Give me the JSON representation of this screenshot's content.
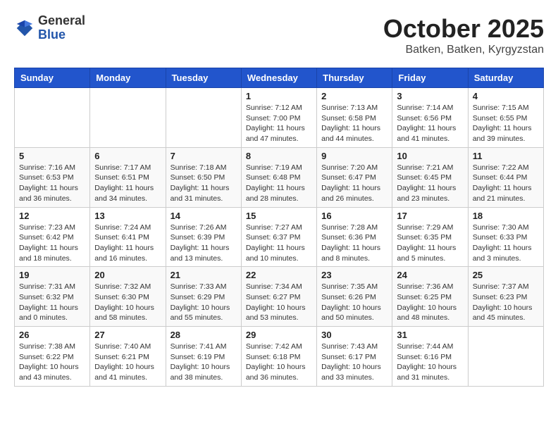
{
  "header": {
    "logo_general": "General",
    "logo_blue": "Blue",
    "month": "October 2025",
    "location": "Batken, Batken, Kyrgyzstan"
  },
  "weekdays": [
    "Sunday",
    "Monday",
    "Tuesday",
    "Wednesday",
    "Thursday",
    "Friday",
    "Saturday"
  ],
  "weeks": [
    [
      {
        "day": "",
        "info": ""
      },
      {
        "day": "",
        "info": ""
      },
      {
        "day": "",
        "info": ""
      },
      {
        "day": "1",
        "info": "Sunrise: 7:12 AM\nSunset: 7:00 PM\nDaylight: 11 hours\nand 47 minutes."
      },
      {
        "day": "2",
        "info": "Sunrise: 7:13 AM\nSunset: 6:58 PM\nDaylight: 11 hours\nand 44 minutes."
      },
      {
        "day": "3",
        "info": "Sunrise: 7:14 AM\nSunset: 6:56 PM\nDaylight: 11 hours\nand 41 minutes."
      },
      {
        "day": "4",
        "info": "Sunrise: 7:15 AM\nSunset: 6:55 PM\nDaylight: 11 hours\nand 39 minutes."
      }
    ],
    [
      {
        "day": "5",
        "info": "Sunrise: 7:16 AM\nSunset: 6:53 PM\nDaylight: 11 hours\nand 36 minutes."
      },
      {
        "day": "6",
        "info": "Sunrise: 7:17 AM\nSunset: 6:51 PM\nDaylight: 11 hours\nand 34 minutes."
      },
      {
        "day": "7",
        "info": "Sunrise: 7:18 AM\nSunset: 6:50 PM\nDaylight: 11 hours\nand 31 minutes."
      },
      {
        "day": "8",
        "info": "Sunrise: 7:19 AM\nSunset: 6:48 PM\nDaylight: 11 hours\nand 28 minutes."
      },
      {
        "day": "9",
        "info": "Sunrise: 7:20 AM\nSunset: 6:47 PM\nDaylight: 11 hours\nand 26 minutes."
      },
      {
        "day": "10",
        "info": "Sunrise: 7:21 AM\nSunset: 6:45 PM\nDaylight: 11 hours\nand 23 minutes."
      },
      {
        "day": "11",
        "info": "Sunrise: 7:22 AM\nSunset: 6:44 PM\nDaylight: 11 hours\nand 21 minutes."
      }
    ],
    [
      {
        "day": "12",
        "info": "Sunrise: 7:23 AM\nSunset: 6:42 PM\nDaylight: 11 hours\nand 18 minutes."
      },
      {
        "day": "13",
        "info": "Sunrise: 7:24 AM\nSunset: 6:41 PM\nDaylight: 11 hours\nand 16 minutes."
      },
      {
        "day": "14",
        "info": "Sunrise: 7:26 AM\nSunset: 6:39 PM\nDaylight: 11 hours\nand 13 minutes."
      },
      {
        "day": "15",
        "info": "Sunrise: 7:27 AM\nSunset: 6:37 PM\nDaylight: 11 hours\nand 10 minutes."
      },
      {
        "day": "16",
        "info": "Sunrise: 7:28 AM\nSunset: 6:36 PM\nDaylight: 11 hours\nand 8 minutes."
      },
      {
        "day": "17",
        "info": "Sunrise: 7:29 AM\nSunset: 6:35 PM\nDaylight: 11 hours\nand 5 minutes."
      },
      {
        "day": "18",
        "info": "Sunrise: 7:30 AM\nSunset: 6:33 PM\nDaylight: 11 hours\nand 3 minutes."
      }
    ],
    [
      {
        "day": "19",
        "info": "Sunrise: 7:31 AM\nSunset: 6:32 PM\nDaylight: 11 hours\nand 0 minutes."
      },
      {
        "day": "20",
        "info": "Sunrise: 7:32 AM\nSunset: 6:30 PM\nDaylight: 10 hours\nand 58 minutes."
      },
      {
        "day": "21",
        "info": "Sunrise: 7:33 AM\nSunset: 6:29 PM\nDaylight: 10 hours\nand 55 minutes."
      },
      {
        "day": "22",
        "info": "Sunrise: 7:34 AM\nSunset: 6:27 PM\nDaylight: 10 hours\nand 53 minutes."
      },
      {
        "day": "23",
        "info": "Sunrise: 7:35 AM\nSunset: 6:26 PM\nDaylight: 10 hours\nand 50 minutes."
      },
      {
        "day": "24",
        "info": "Sunrise: 7:36 AM\nSunset: 6:25 PM\nDaylight: 10 hours\nand 48 minutes."
      },
      {
        "day": "25",
        "info": "Sunrise: 7:37 AM\nSunset: 6:23 PM\nDaylight: 10 hours\nand 45 minutes."
      }
    ],
    [
      {
        "day": "26",
        "info": "Sunrise: 7:38 AM\nSunset: 6:22 PM\nDaylight: 10 hours\nand 43 minutes."
      },
      {
        "day": "27",
        "info": "Sunrise: 7:40 AM\nSunset: 6:21 PM\nDaylight: 10 hours\nand 41 minutes."
      },
      {
        "day": "28",
        "info": "Sunrise: 7:41 AM\nSunset: 6:19 PM\nDaylight: 10 hours\nand 38 minutes."
      },
      {
        "day": "29",
        "info": "Sunrise: 7:42 AM\nSunset: 6:18 PM\nDaylight: 10 hours\nand 36 minutes."
      },
      {
        "day": "30",
        "info": "Sunrise: 7:43 AM\nSunset: 6:17 PM\nDaylight: 10 hours\nand 33 minutes."
      },
      {
        "day": "31",
        "info": "Sunrise: 7:44 AM\nSunset: 6:16 PM\nDaylight: 10 hours\nand 31 minutes."
      },
      {
        "day": "",
        "info": ""
      }
    ]
  ]
}
